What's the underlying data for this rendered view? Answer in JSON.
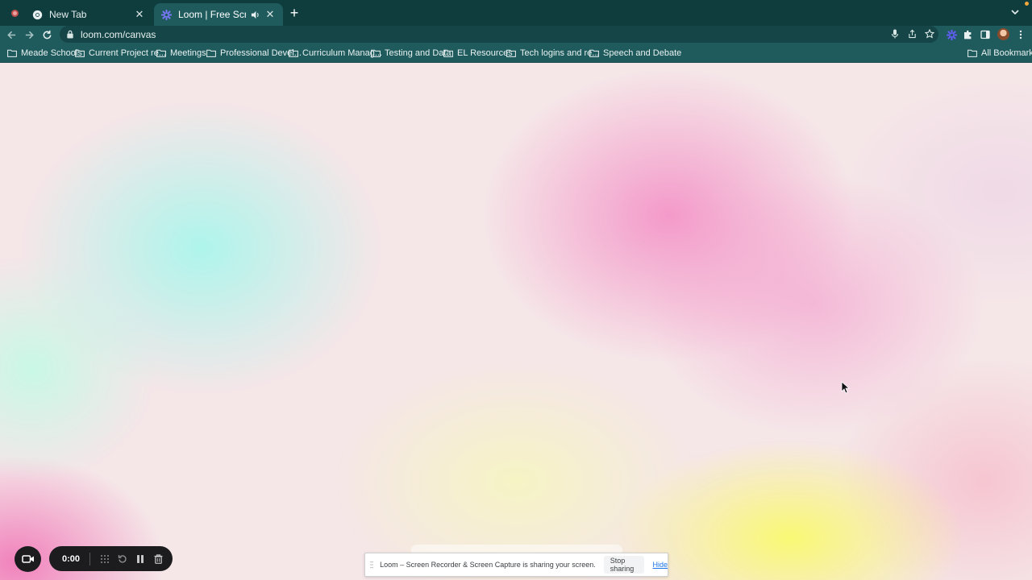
{
  "browser": {
    "tabs": [
      {
        "title": "New Tab",
        "icon": "chrome-icon",
        "active": false
      },
      {
        "title": "Loom | Free Screen & Video",
        "icon": "loom-icon",
        "active": true
      }
    ],
    "url": "loom.com/canvas",
    "bookmarks": [
      "Meade Schools",
      "Current Project re...",
      "Meetings",
      "Professional Devel...",
      "Curriculum Manag...",
      "Testing and Data",
      "EL Resources",
      "Tech logins and re...",
      "Speech and Debate"
    ],
    "all_bookmarks": "All Bookmarks"
  },
  "recorder": {
    "timer": "0:00"
  },
  "share_notice": {
    "message": "Loom – Screen Recorder & Screen Capture is sharing your screen.",
    "stop_label": "Stop sharing",
    "hide_label": "Hide"
  },
  "colors": {
    "chrome_dark": "#0f3d3e",
    "chrome_toolbar": "#1f5b5d",
    "loom_purple": "#625df5",
    "recorder_bg": "#1c1c1f",
    "link_blue": "#1a73e8"
  }
}
